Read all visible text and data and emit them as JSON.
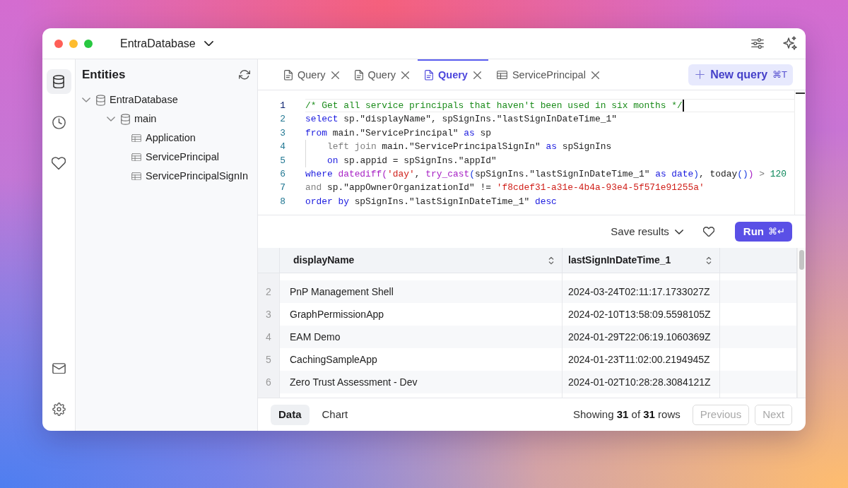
{
  "window": {
    "title": "EntraDatabase"
  },
  "rail": {
    "top_items": [
      {
        "selected": true
      },
      {
        "selected": false
      },
      {
        "selected": false
      }
    ],
    "bottom_items": [
      {
        "selected": false
      },
      {
        "selected": false
      }
    ]
  },
  "entities": {
    "title": "Entities",
    "tree": [
      {
        "label": "EntraDatabase",
        "kind": "database",
        "expanded": true,
        "children": [
          {
            "label": "main",
            "kind": "database",
            "expanded": true,
            "children": [
              {
                "label": "Application",
                "kind": "table"
              },
              {
                "label": "ServicePrincipal",
                "kind": "table"
              },
              {
                "label": "ServicePrincipalSignIn",
                "kind": "table"
              }
            ]
          }
        ]
      }
    ]
  },
  "tabs": [
    {
      "label": "Query",
      "kind": "query",
      "selected": false
    },
    {
      "label": "Query",
      "kind": "query",
      "selected": false
    },
    {
      "label": "Query",
      "kind": "query",
      "selected": true
    },
    {
      "label": "ServicePrincipal",
      "kind": "table",
      "selected": false
    }
  ],
  "new_query": {
    "label": "New query",
    "shortcut": "⌘T"
  },
  "editor": {
    "lines": [
      {
        "number": "1",
        "active": true,
        "indented": false,
        "tokens": [
          {
            "kind": "comment",
            "text": "/* Get all service principals that haven't been used in six months */"
          }
        ]
      },
      {
        "number": "2",
        "active": false,
        "indented": false,
        "tokens": [
          {
            "kind": "keyword",
            "text": "select"
          },
          {
            "kind": "plain",
            "text": " sp.\"displayName\", spSignIns.\"lastSignInDateTime_1\""
          }
        ]
      },
      {
        "number": "3",
        "active": false,
        "indented": false,
        "tokens": [
          {
            "kind": "keyword",
            "text": "from"
          },
          {
            "kind": "plain",
            "text": " main.\"ServicePrincipal\" "
          },
          {
            "kind": "keyword",
            "text": "as"
          },
          {
            "kind": "plain",
            "text": " sp"
          }
        ]
      },
      {
        "number": "4",
        "active": false,
        "indented": true,
        "tokens": [
          {
            "kind": "soft",
            "text": "left join"
          },
          {
            "kind": "plain",
            "text": " main.\"ServicePrincipalSignIn\" "
          },
          {
            "kind": "keyword",
            "text": "as"
          },
          {
            "kind": "plain",
            "text": " spSignIns"
          }
        ]
      },
      {
        "number": "5",
        "active": false,
        "indented": true,
        "tokens": [
          {
            "kind": "keyword",
            "text": "on"
          },
          {
            "kind": "plain",
            "text": " sp.appid = spSignIns.\"appId\""
          }
        ]
      },
      {
        "number": "6",
        "active": false,
        "indented": false,
        "tokens": [
          {
            "kind": "keyword",
            "text": "where "
          },
          {
            "kind": "function",
            "text": "datediff"
          },
          {
            "kind": "bracket",
            "text": "("
          },
          {
            "kind": "string",
            "text": "'day'"
          },
          {
            "kind": "plain",
            "text": ", "
          },
          {
            "kind": "function",
            "text": "try_cast"
          },
          {
            "kind": "bracket2",
            "text": "("
          },
          {
            "kind": "plain",
            "text": "spSignIns.\"lastSignInDateTime_1\" "
          },
          {
            "kind": "keyword",
            "text": "as date"
          },
          {
            "kind": "bracket2",
            "text": ")"
          },
          {
            "kind": "plain",
            "text": ", today"
          },
          {
            "kind": "bracket2",
            "text": "()"
          },
          {
            "kind": "bracket",
            "text": ")"
          },
          {
            "kind": "soft",
            "text": " > "
          },
          {
            "kind": "number",
            "text": "120"
          }
        ]
      },
      {
        "number": "7",
        "active": false,
        "indented": false,
        "tokens": [
          {
            "kind": "soft",
            "text": "and"
          },
          {
            "kind": "plain",
            "text": " sp.\"appOwnerOrganizationId\" != "
          },
          {
            "kind": "string",
            "text": "'f8cdef31-a31e-4b4a-93e4-5f571e91255a'"
          }
        ]
      },
      {
        "number": "8",
        "active": false,
        "indented": false,
        "tokens": [
          {
            "kind": "keyword",
            "text": "order by"
          },
          {
            "kind": "plain",
            "text": " spSignIns.\"lastSignInDateTime_1\" "
          },
          {
            "kind": "keyword",
            "text": "desc"
          }
        ]
      }
    ]
  },
  "results_toolbar": {
    "save_label": "Save results",
    "run_label": "Run",
    "run_shortcut": "⌘↵"
  },
  "table": {
    "columns": [
      {
        "label": "displayName"
      },
      {
        "label": "lastSignInDateTime_1"
      }
    ],
    "rows": [
      {
        "number": "2",
        "cells": [
          "PnP Management Shell",
          "2024-03-24T02:11:17.1733027Z"
        ]
      },
      {
        "number": "3",
        "cells": [
          "GraphPermissionApp",
          "2024-02-10T13:58:09.5598105Z"
        ]
      },
      {
        "number": "4",
        "cells": [
          "EAM Demo",
          "2024-01-29T22:06:19.1060369Z"
        ]
      },
      {
        "number": "5",
        "cells": [
          "CachingSampleApp",
          "2024-01-23T11:02:00.2194945Z"
        ]
      },
      {
        "number": "6",
        "cells": [
          "Zero Trust Assessment - Dev",
          "2024-01-02T10:28:28.3084121Z"
        ]
      }
    ]
  },
  "footer": {
    "views": [
      {
        "label": "Data",
        "selected": true
      },
      {
        "label": "Chart",
        "selected": false
      }
    ],
    "summary": "Showing **31** of **31** rows",
    "pager": [
      {
        "label": "Previous",
        "disabled": true
      },
      {
        "label": "Next",
        "disabled": true
      }
    ]
  }
}
